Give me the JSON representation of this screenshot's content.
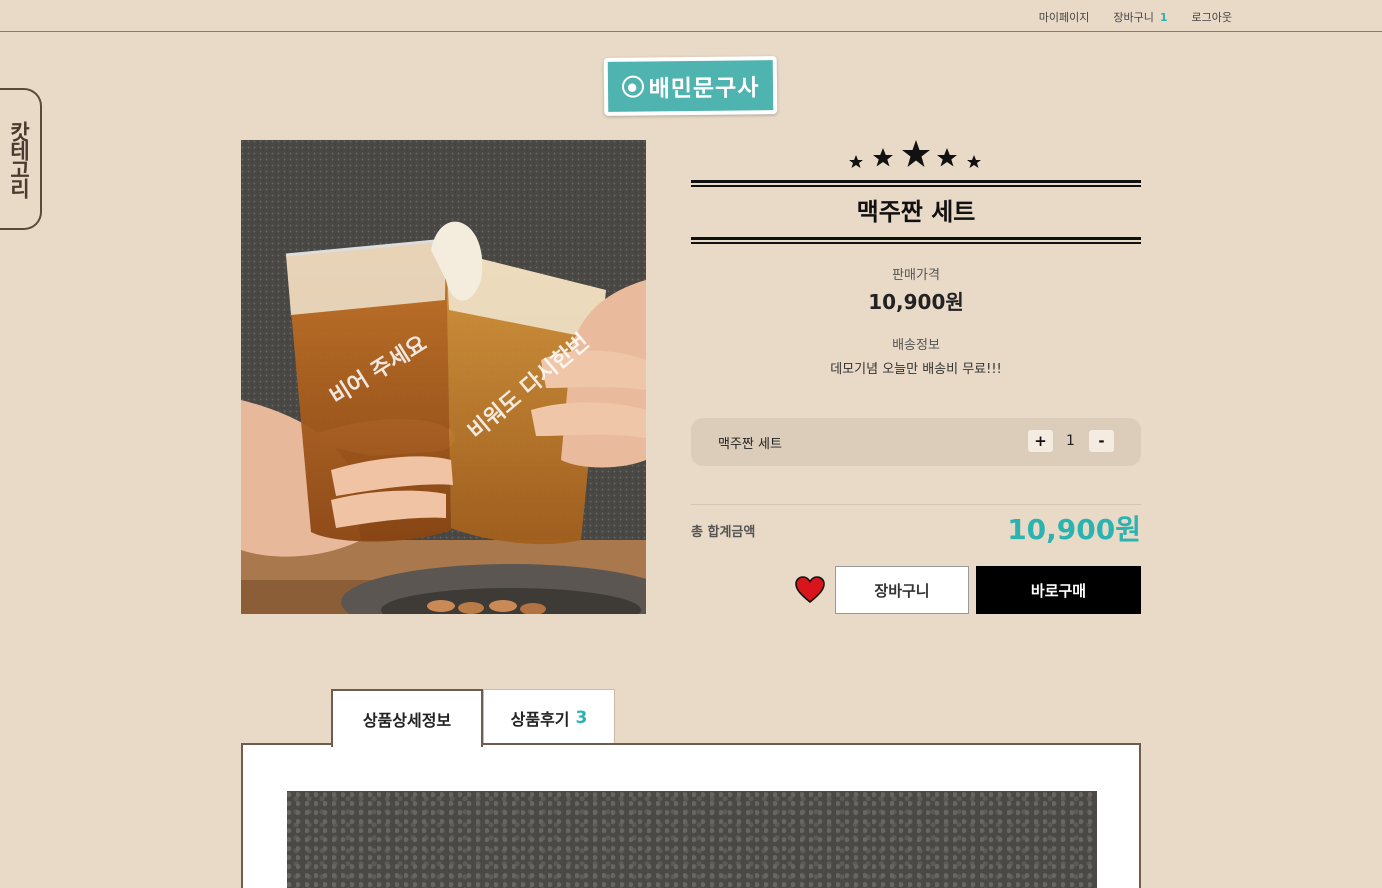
{
  "topnav": {
    "mypage": "마이페이지",
    "cart": "장바구니",
    "cart_count": "1",
    "logout": "로그아웃"
  },
  "sidebar": {
    "category_label": "캇테고리"
  },
  "logo": {
    "text": "배민문구사"
  },
  "product": {
    "image_text_1": "비어 주세요",
    "image_text_2": "비워도 다시한번",
    "title": "맥주짠 세트",
    "price_label": "판매가격",
    "price": "10,900원",
    "shipping_label": "배송정보",
    "shipping_text": "데모기념 오늘만 배송비 무료!!!"
  },
  "option": {
    "name": "맥주짠 세트",
    "plus": "+",
    "quantity": "1",
    "minus": "-"
  },
  "total": {
    "label": "총 합계금액",
    "price": "10,900원"
  },
  "actions": {
    "cart_button": "장바구니",
    "buy_button": "바로구매"
  },
  "tabs": {
    "detail": "상품상세정보",
    "review": "상품후기",
    "review_count": "3"
  },
  "colors": {
    "background": "#e9dac8",
    "accent": "#2ab3b0",
    "logo_teal": "#4fb3b0",
    "buy_button": "#000000",
    "heart": "#d9141b"
  }
}
